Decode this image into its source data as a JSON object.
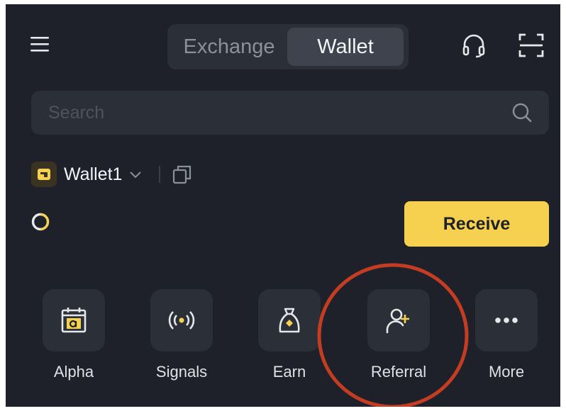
{
  "header": {
    "menu_icon": "hamburger-icon",
    "tabs": [
      {
        "label": "Exchange",
        "active": false
      },
      {
        "label": "Wallet",
        "active": true
      }
    ],
    "support_icon": "headset-icon",
    "scan_icon": "scan-icon"
  },
  "search": {
    "placeholder": "Search",
    "value": "",
    "icon": "search-icon"
  },
  "wallet": {
    "name": "Wallet1",
    "icon": "wallet-icon",
    "dropdown_icon": "chevron-down-icon",
    "copy_icon": "copy-icon"
  },
  "status": {
    "icon": "loading-icon"
  },
  "receive": {
    "label": "Receive"
  },
  "quick_actions": [
    {
      "label": "Alpha",
      "icon": "alpha-calendar-icon"
    },
    {
      "label": "Signals",
      "icon": "signals-icon"
    },
    {
      "label": "Earn",
      "icon": "money-bag-icon"
    },
    {
      "label": "Referral",
      "icon": "add-user-icon"
    },
    {
      "label": "More",
      "icon": "more-dots-icon"
    }
  ],
  "colors": {
    "background": "#1e2129",
    "surface": "#2b2f38",
    "accent": "#f5d14f",
    "annotation": "#c43c22"
  }
}
